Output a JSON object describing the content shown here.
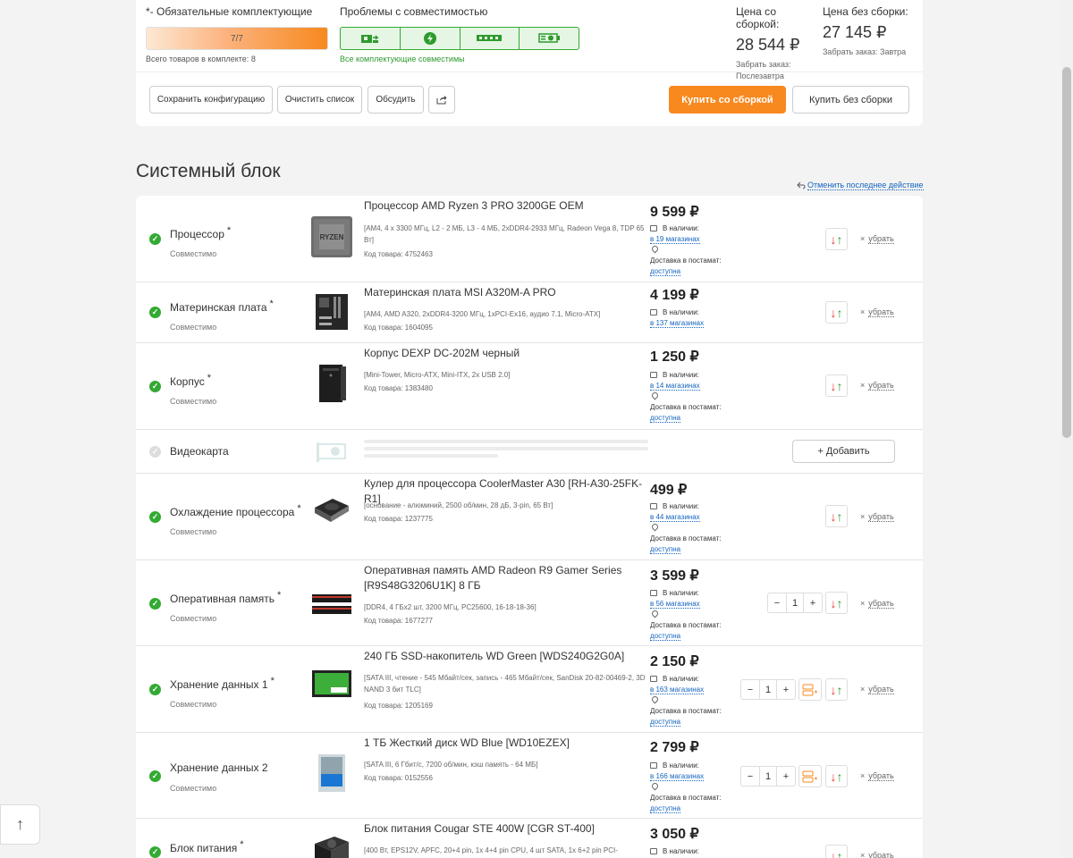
{
  "summary": {
    "required_label": "*- Обязательные комплектующие",
    "progress_text": "7/7",
    "total_items": "Всего товаров в комплекте: 8",
    "compat_label": "Проблемы с совместимостью",
    "compat_ok": "Все комплектующие совместимы",
    "compat_icons": [
      "motherboard-icon",
      "power-icon",
      "ram-icon",
      "gpu-icon"
    ],
    "price_with_label": "Цена со сборкой:",
    "price_with": "28 544 ₽",
    "price_with_pickup": "Забрать заказ: Послезавтра",
    "price_without_label": "Цена без сборки:",
    "price_without": "27 145 ₽",
    "price_without_pickup": "Забрать заказ: Завтра"
  },
  "actions": {
    "save": "Сохранить конфигурацию",
    "clear": "Очистить список",
    "discuss": "Обсудить",
    "share": "share-icon",
    "buy_with": "Купить со сборкой",
    "buy_without": "Купить без сборки"
  },
  "section": {
    "title": "Системный блок",
    "undo": "Отменить последнее действие"
  },
  "common": {
    "compatible": "Совместимо",
    "in_stock": "В наличии:",
    "delivery": "Доставка в постамат:",
    "available": "доступна",
    "remove": "убрать",
    "add": "+ Добавить"
  },
  "rows": [
    {
      "category": "Процессор",
      "required": "*",
      "name": "Процессор AMD Ryzen 3 PRO 3200GE OEM",
      "spec": "[AM4, 4 x 3300 МГц, L2 - 2 МБ, L3 - 4 МБ, 2xDDR4-2933 МГц, Radeon Vega 8, TDP 65 Вт]",
      "code": "Код товара: 4752463",
      "price": "9 599 ₽",
      "stores": "в 19 магазинах"
    },
    {
      "category": "Материнская плата",
      "required": "*",
      "name": "Материнская плата MSI A320M-A PRO",
      "spec": "[AM4, AMD A320, 2xDDR4-3200 МГц, 1xPCI-Ex16, аудио 7.1, Micro-ATX]",
      "code": "Код товара: 1604095",
      "price": "4 199 ₽",
      "stores": "в 137 магазинах"
    },
    {
      "category": "Корпус",
      "required": "*",
      "name": "Корпус DEXP DC-202M черный",
      "spec": "[Mini-Tower, Micro-ATX, Mini-ITX, 2x USB 2.0]",
      "code": "Код товара: 1383480",
      "price": "1 250 ₽",
      "stores": "в 14 магазинах"
    },
    {
      "category": "Видеокарта"
    },
    {
      "category": "Охлаждение процессора",
      "required": "*",
      "name": "Кулер для процессора CoolerMaster A30 [RH-A30-25FK-R1]",
      "spec": "[основание - алюминий, 2500 об/мин, 28 дБ, 3-pin, 65 Вт]",
      "code": "Код товара: 1237775",
      "price": "499 ₽",
      "stores": "в 44 магазинах"
    },
    {
      "category": "Оперативная память",
      "required": "*",
      "name": "Оперативная память AMD Radeon R9 Gamer Series [R9S48G3206U1K] 8 ГБ",
      "spec": "[DDR4, 4 ГБx2 шт, 3200 МГц, PC25600, 16-18-18-36]",
      "code": "Код товара: 1677277",
      "price": "3 599 ₽",
      "stores": "в 56 магазинах",
      "qty": "1"
    },
    {
      "category": "Хранение данных 1",
      "required": "*",
      "name": "240 ГБ SSD-накопитель WD Green [WDS240G2G0A]",
      "spec": "[SATA III, чтение - 545 Мбайт/сек, запись - 465 Мбайт/сек, SanDisk 20-82-00469-2, 3D NAND 3 бит TLC]",
      "code": "Код товара: 1205169",
      "price": "2 150 ₽",
      "stores": "в 163 магазинах",
      "qty": "1"
    },
    {
      "category": "Хранение данных 2",
      "name": "1 ТБ Жесткий диск WD Blue [WD10EZEX]",
      "spec": "[SATA III, 6 Гбит/с, 7200 об/мин, кэш память - 64 МБ]",
      "code": "Код товара: 0152556",
      "price": "2 799 ₽",
      "stores": "в 166 магазинах",
      "qty": "1"
    },
    {
      "category": "Блок питания",
      "required": "*",
      "name": "Блок питания Cougar STE 400W [CGR ST-400]",
      "spec": "[400 Вт, EPS12V, APFC, 20+4 pin, 1x 4+4 pin CPU, 4 шт SATA, 1x 6+2 pin PCI-",
      "price": "3 050 ₽"
    }
  ],
  "colors": {
    "accent": "#f7891f",
    "ok": "#33aa33",
    "link": "#1565c0"
  }
}
